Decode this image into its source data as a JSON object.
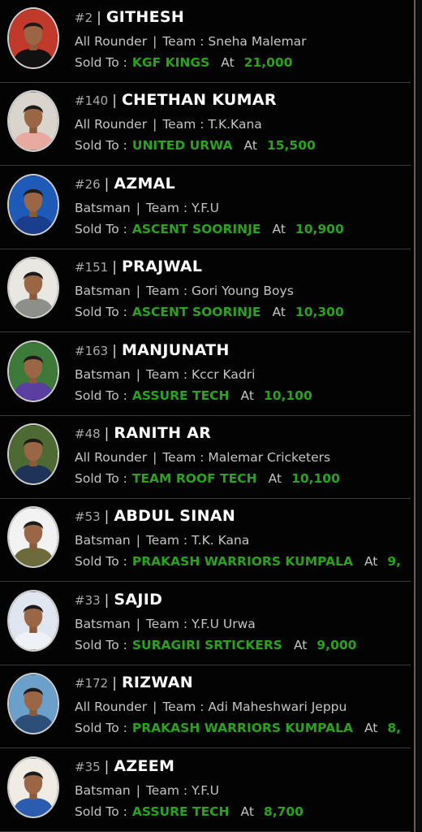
{
  "labels": {
    "team_prefix": "Team :",
    "sold_to": "Sold To :",
    "at": "At",
    "separator": "|"
  },
  "players": [
    {
      "num": "#2",
      "name": "GITHESH",
      "role": "All Rounder",
      "team": "Sneha Malemar",
      "buyer": "KGF KINGS",
      "price": "21,000",
      "avatar_bg": "#c0392b",
      "shirt": "#111111"
    },
    {
      "num": "#140",
      "name": "CHETHAN KUMAR",
      "role": "All Rounder",
      "team": "T.K.Kana",
      "buyer": "UNITED URWA",
      "price": "15,500",
      "avatar_bg": "#d9d4cc",
      "shirt": "#e8a9a0"
    },
    {
      "num": "#26",
      "name": "AZMAL",
      "role": "Batsman",
      "team": "Y.F.U",
      "buyer": "ASCENT SOORINJE",
      "price": "10,900",
      "avatar_bg": "#1e5bb8",
      "shirt": "#1a3e8c"
    },
    {
      "num": "#151",
      "name": "PRAJWAL",
      "role": "Batsman",
      "team": "Gori Young Boys",
      "buyer": "ASCENT SOORINJE",
      "price": "10,300",
      "avatar_bg": "#e9e7e2",
      "shirt": "#8c8f8a"
    },
    {
      "num": "#163",
      "name": "MANJUNATH",
      "role": "Batsman",
      "team": "Kccr Kadri",
      "buyer": "ASSURE TECH",
      "price": "10,100",
      "avatar_bg": "#3d7a3a",
      "shirt": "#5b3fa0"
    },
    {
      "num": "#48",
      "name": "RANITH AR",
      "role": "All Rounder",
      "team": "Malemar Cricketers",
      "buyer": "TEAM ROOF TECH",
      "price": "10,100",
      "avatar_bg": "#4d6a33",
      "shirt": "#1e3357"
    },
    {
      "num": "#53",
      "name": "ABDUL SINAN",
      "role": "Batsman",
      "team": "T.K. Kana",
      "buyer": "PRAKASH WARRIORS KUMPALA",
      "price": "9,",
      "avatar_bg": "#f2f2f2",
      "shirt": "#6b6b3c"
    },
    {
      "num": "#33",
      "name": "SAJID",
      "role": "Batsman",
      "team": "Y.F.U Urwa",
      "buyer": "SURAGIRI SRTICKERS",
      "price": "9,000",
      "avatar_bg": "#dfe6ef",
      "shirt": "#eef1f5"
    },
    {
      "num": "#172",
      "name": "RIZWAN",
      "role": "All Rounder",
      "team": "Adi Maheshwari Jeppu",
      "buyer": "PRAKASH WARRIORS KUMPALA",
      "price": "8,",
      "avatar_bg": "#6aa0c9",
      "shirt": "#2c4f7a"
    },
    {
      "num": "#35",
      "name": "AZEEM",
      "role": "Batsman",
      "team": "Y.F.U",
      "buyer": "ASSURE TECH",
      "price": "8,700",
      "avatar_bg": "#f0ece4",
      "shirt": "#2a5db0"
    }
  ]
}
